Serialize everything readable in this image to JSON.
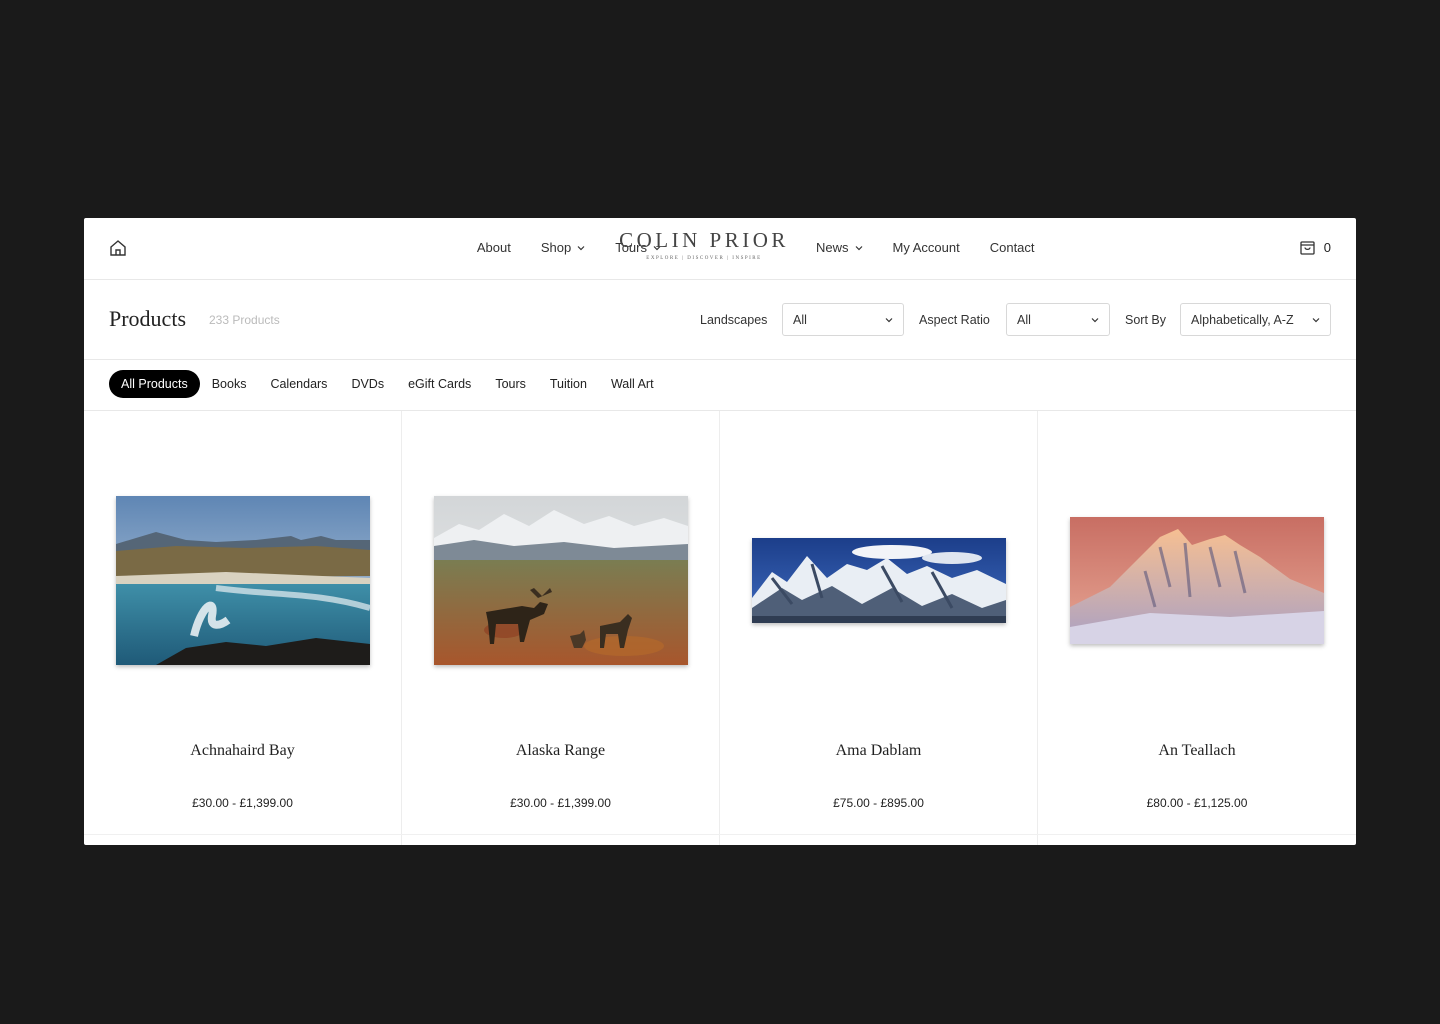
{
  "header": {
    "nav_left": [
      {
        "label": "About",
        "dropdown": false
      },
      {
        "label": "Shop",
        "dropdown": true
      },
      {
        "label": "Tours",
        "dropdown": true
      }
    ],
    "logo_title": "COLIN PRIOR",
    "logo_tagline": "EXPLORE | DISCOVER | INSPIRE",
    "nav_right": [
      {
        "label": "News",
        "dropdown": true
      },
      {
        "label": "My Account",
        "dropdown": false
      },
      {
        "label": "Contact",
        "dropdown": false
      }
    ],
    "cart_count": "0"
  },
  "toolbar": {
    "title": "Products",
    "count": "233 Products",
    "landscapes_label": "Landscapes",
    "landscapes_value": "All",
    "aspect_label": "Aspect Ratio",
    "aspect_value": "All",
    "sort_label": "Sort By",
    "sort_value": "Alphabetically, A-Z"
  },
  "categories": [
    "All Products",
    "Books",
    "Calendars",
    "DVDs",
    "eGift Cards",
    "Tours",
    "Tuition",
    "Wall Art"
  ],
  "active_category": "All Products",
  "products": [
    {
      "name": "Achnahaird Bay",
      "price": "£30.00 - £1,399.00"
    },
    {
      "name": "Alaska Range",
      "price": "£30.00 - £1,399.00"
    },
    {
      "name": "Ama Dablam",
      "price": "£75.00 - £895.00"
    },
    {
      "name": "An Teallach",
      "price": "£80.00 - £1,125.00"
    }
  ],
  "colors": {
    "background": "#1a1a1a",
    "page": "#ffffff",
    "active_pill": "#000000"
  },
  "icons": {
    "home": "home-icon",
    "cart": "shopping-bag-icon",
    "dropdown": "chevron-down-icon"
  }
}
